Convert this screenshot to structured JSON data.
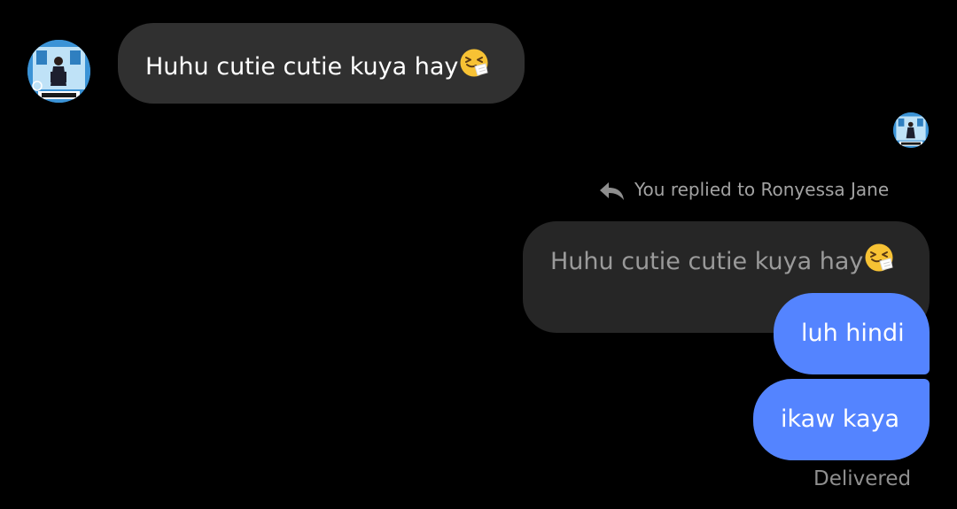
{
  "thread": {
    "incoming": {
      "avatar_icon": "contact-avatar-photo",
      "text": "Huhu cutie cutie kuya hay",
      "emoji": "sneezing-face-emoji"
    },
    "seen_avatar_icon": "seen-avatar-photo",
    "reply_indicator": {
      "icon": "reply-arrow-icon",
      "text": "You replied to Ronyessa Jane"
    },
    "quoted_message": {
      "text": "Huhu cutie cutie kuya hay",
      "emoji": "sneezing-face-emoji"
    },
    "outgoing": [
      {
        "text": "luh hindi"
      },
      {
        "text": "ikaw kaya"
      }
    ],
    "status": "Delivered"
  },
  "colors": {
    "background": "#000000",
    "incoming_bubble": "#303030",
    "quoted_bubble": "#262626",
    "outgoing_bubble": "#5484ff",
    "muted_text": "#a3a3a3"
  }
}
